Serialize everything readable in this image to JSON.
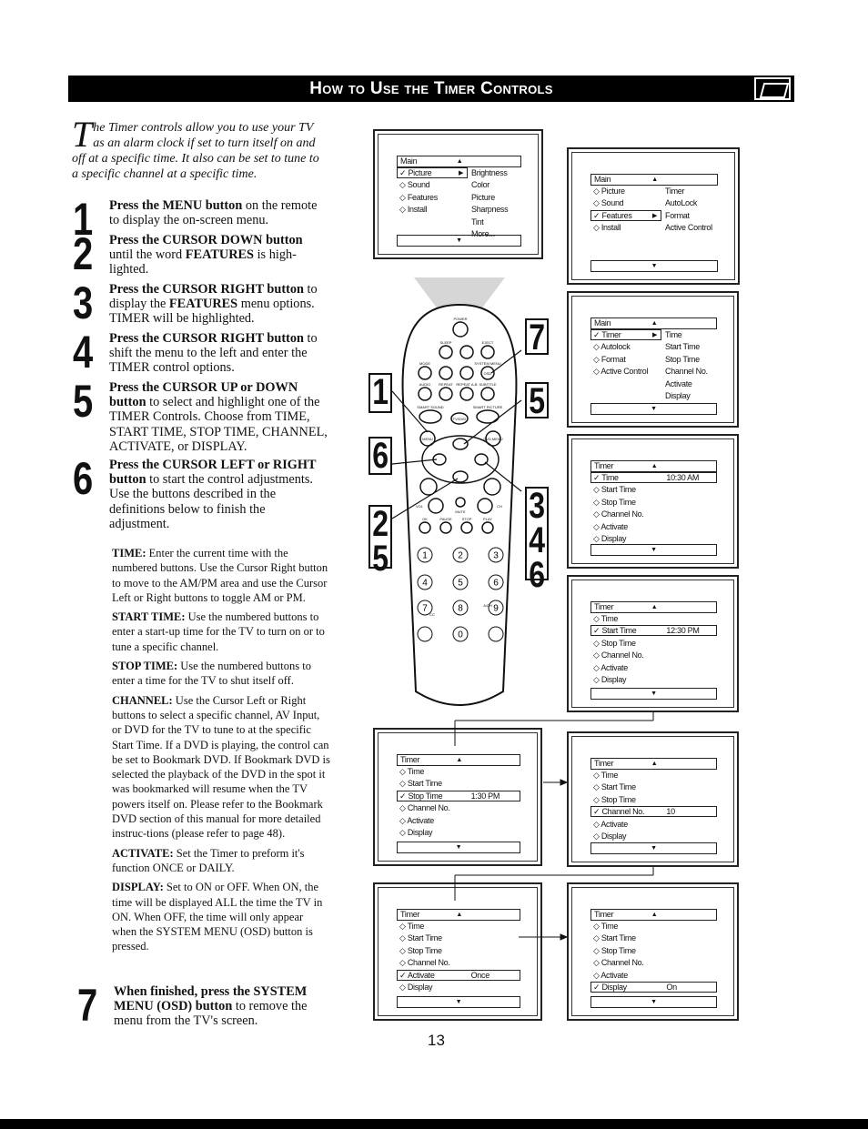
{
  "header": {
    "title": "How to Use the Timer Controls",
    "icon": "remote-hand-icon"
  },
  "intro": {
    "dropcap": "T",
    "text": "he Timer controls allow you to use your TV as an alarm clock if set to turn itself on and off at a specific time. It also can be set to tune to a specific channel at a specific time."
  },
  "steps": [
    {
      "num": "1",
      "bold": "Press the MENU button",
      "rest": " on the remote to display the on-screen menu."
    },
    {
      "num": "2",
      "bold": "Press the CURSOR DOWN button",
      "rest": " until the word ",
      "bold2": "FEATURES",
      "rest2": " is high-lighted."
    },
    {
      "num": "3",
      "bold": "Press the CURSOR RIGHT button",
      "rest": " to display the ",
      "bold2": "FEATURES",
      "rest2": " menu options. TIMER will be highlighted."
    },
    {
      "num": "4",
      "bold": "Press the CURSOR RIGHT button",
      "rest": " to shift the menu to the left and enter the TIMER control options."
    },
    {
      "num": "5",
      "bold": "Press the CURSOR UP or DOWN button",
      "rest": "  to select and highlight one of the TIMER Controls. Choose from TIME, START TIME, STOP TIME, CHANNEL, ACTIVATE, or DISPLAY."
    },
    {
      "num": "6",
      "bold": "Press the CURSOR LEFT or RIGHT button",
      "rest": " to start the control adjustments. Use the buttons described in the definitions below to finish the adjustment."
    },
    {
      "num": "7",
      "bold": "When finished, press the SYSTEM MENU (OSD) button",
      "rest": " to remove the menu from the TV's screen."
    }
  ],
  "definitions": [
    {
      "term": "TIME:",
      "text": " Enter the current time with the numbered buttons. Use the Cursor Right button to move to the AM/PM area and use the Cursor Left or Right buttons to toggle AM or PM."
    },
    {
      "term": "START TIME:",
      "text": " Use the numbered buttons to enter a start-up time for the TV to turn on or to tune a specific channel."
    },
    {
      "term": "STOP TIME:",
      "text": " Use the numbered buttons to enter a time for the TV to shut itself off."
    },
    {
      "term": "CHANNEL:",
      "text": " Use the Cursor Left or Right buttons to select a specific channel, AV Input, or DVD for the TV to tune to at the specific Start Time. If a DVD is playing, the control can be set to Bookmark DVD. If Bookmark DVD is selected the playback of the DVD in the spot it was bookmarked will resume when the TV powers itself on. Please refer to the Bookmark DVD section of this manual for more detailed instruc-tions (please refer to page 48)."
    },
    {
      "term": "ACTIVATE:",
      "text": " Set the Timer to preform it's function ONCE or DAILY."
    },
    {
      "term": "DISPLAY:",
      "text": " Set to ON or OFF. When ON, the time will be displayed ALL the time the TV in ON. When OFF, the time will only appear when the SYSTEM MENU (OSD) button is pressed."
    }
  ],
  "screens": [
    {
      "header": "Main",
      "rows": [
        {
          "left": "Picture",
          "right": "Brightness",
          "sel": true,
          "arrow": true
        },
        {
          "left": "Sound",
          "right": "Color"
        },
        {
          "left": "Features",
          "right": "Picture"
        },
        {
          "left": "Install",
          "right": "Sharpness"
        },
        {
          "left": "",
          "right": "Tint"
        },
        {
          "left": "",
          "right": "More..."
        }
      ]
    },
    {
      "header": "Main",
      "rows": [
        {
          "left": "Picture",
          "right": "Timer"
        },
        {
          "left": "Sound",
          "right": "AutoLock"
        },
        {
          "left": "Features",
          "right": "Format",
          "sel": true,
          "arrow": true
        },
        {
          "left": "Install",
          "right": "Active Control"
        }
      ]
    },
    {
      "header": "Main",
      "rows": [
        {
          "left": "Timer",
          "right": "Time",
          "sel": true,
          "arrow": true
        },
        {
          "left": "Autolock",
          "right": "Start Time"
        },
        {
          "left": "Format",
          "right": "Stop Time"
        },
        {
          "left": "Active Control",
          "right": "Channel No."
        },
        {
          "left": "",
          "right": "Activate"
        },
        {
          "left": "",
          "right": "Display"
        }
      ]
    },
    {
      "header": "Timer",
      "rows": [
        {
          "left": "Time",
          "sel": true,
          "full": true,
          "value": "10:30 AM"
        },
        {
          "left": "Start Time"
        },
        {
          "left": "Stop Time"
        },
        {
          "left": "Channel No."
        },
        {
          "left": "Activate"
        },
        {
          "left": "Display"
        }
      ]
    },
    {
      "header": "Timer",
      "rows": [
        {
          "left": "Time"
        },
        {
          "left": "Start Time",
          "sel": true,
          "full": true,
          "value": "12:30 PM"
        },
        {
          "left": "Stop Time"
        },
        {
          "left": "Channel No."
        },
        {
          "left": "Activate"
        },
        {
          "left": "Display"
        }
      ]
    },
    {
      "header": "Timer",
      "rows": [
        {
          "left": "Time"
        },
        {
          "left": "Start Time"
        },
        {
          "left": "Stop Time",
          "sel": true,
          "full": true,
          "value": "1:30 PM"
        },
        {
          "left": "Channel No."
        },
        {
          "left": "Activate"
        },
        {
          "left": "Display"
        }
      ]
    },
    {
      "header": "Timer",
      "rows": [
        {
          "left": "Time"
        },
        {
          "left": "Start Time"
        },
        {
          "left": "Stop Time"
        },
        {
          "left": "Channel No.",
          "sel": true,
          "full": true,
          "value": "10"
        },
        {
          "left": "Activate"
        },
        {
          "left": "Display"
        }
      ]
    },
    {
      "header": "Timer",
      "rows": [
        {
          "left": "Time"
        },
        {
          "left": "Start Time"
        },
        {
          "left": "Stop Time"
        },
        {
          "left": "Channel No."
        },
        {
          "left": "Activate",
          "sel": true,
          "full": true,
          "value": "Once"
        },
        {
          "left": "Display"
        }
      ]
    },
    {
      "header": "Timer",
      "rows": [
        {
          "left": "Time"
        },
        {
          "left": "Start Time"
        },
        {
          "left": "Stop Time"
        },
        {
          "left": "Channel No."
        },
        {
          "left": "Activate"
        },
        {
          "left": "Display",
          "sel": true,
          "full": true,
          "value": "On"
        }
      ]
    }
  ],
  "remote": {
    "labels": {
      "power": "POWER",
      "sleep": "SLEEP",
      "eject": "EJECT",
      "tv": "TV",
      "vcr": "VCR",
      "mode": "MODE",
      "system_menu": "SYSTEM MENU",
      "osd": "OSD",
      "audio": "AUDIO",
      "repeat": "REPEAT",
      "repeat_ab": "REPEAT A-B",
      "subtitle": "SUBTITLE",
      "smart_sound": "SMART SOUND",
      "tvdvd": "TV/DVD",
      "smart_picture": "SMART PICTURE",
      "menu": "MENU",
      "dvd_menu": "DVD MENU",
      "vol": "VOL",
      "ch": "CH",
      "mute": "MUTE",
      "ok": "OK",
      "pause": "PAUSE",
      "stop": "STOP",
      "play": "PLAY",
      "cc": "CC",
      "ach": "A/CH"
    },
    "digits": [
      "1",
      "2",
      "3",
      "4",
      "5",
      "6",
      "7",
      "8",
      "9",
      "0"
    ],
    "callouts": {
      "c1": "1",
      "c7": "7",
      "c5": "5",
      "c6": "6",
      "c25": [
        "2",
        "5"
      ],
      "c346": [
        "3",
        "4",
        "6"
      ]
    }
  },
  "page_number": "13"
}
